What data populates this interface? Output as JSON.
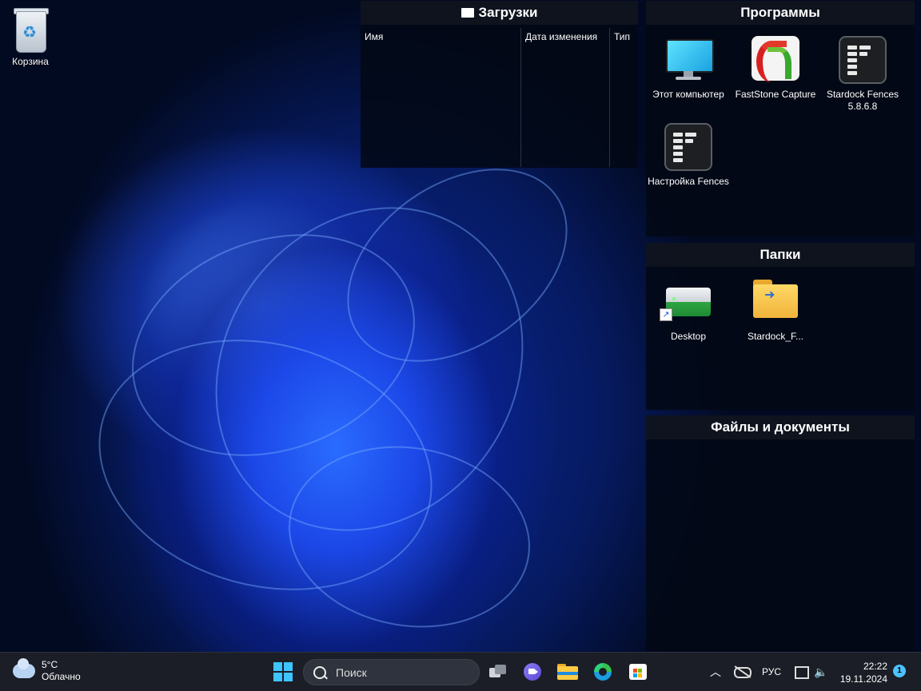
{
  "desktop": {
    "recycle_bin_label": "Корзина"
  },
  "fences": {
    "downloads": {
      "title": "Загрузки",
      "columns": [
        "Имя",
        "Дата изменения",
        "Тип"
      ]
    },
    "programs": {
      "title": "Программы",
      "items": [
        {
          "label": "Этот компьютер",
          "icon": "this-pc-icon"
        },
        {
          "label": "FastStone Capture",
          "icon": "faststone-capture-icon"
        },
        {
          "label": "Stardock Fences 5.8.6.8",
          "icon": "stardock-fences-icon"
        },
        {
          "label": "Настройка Fences",
          "icon": "fences-settings-icon"
        }
      ]
    },
    "folders": {
      "title": "Папки",
      "items": [
        {
          "label": "Desktop",
          "icon": "desktop-drive-icon"
        },
        {
          "label": "Stardock_F...",
          "icon": "stardock-folder-icon"
        }
      ]
    },
    "files": {
      "title": "Файлы и документы"
    }
  },
  "taskbar": {
    "weather": {
      "temp": "5°C",
      "condition": "Облачно"
    },
    "search_placeholder": "Поиск",
    "language": "РУС",
    "time": "22:22",
    "date": "19.11.2024",
    "notification_count": "1",
    "accent": "#3ec5ff"
  }
}
